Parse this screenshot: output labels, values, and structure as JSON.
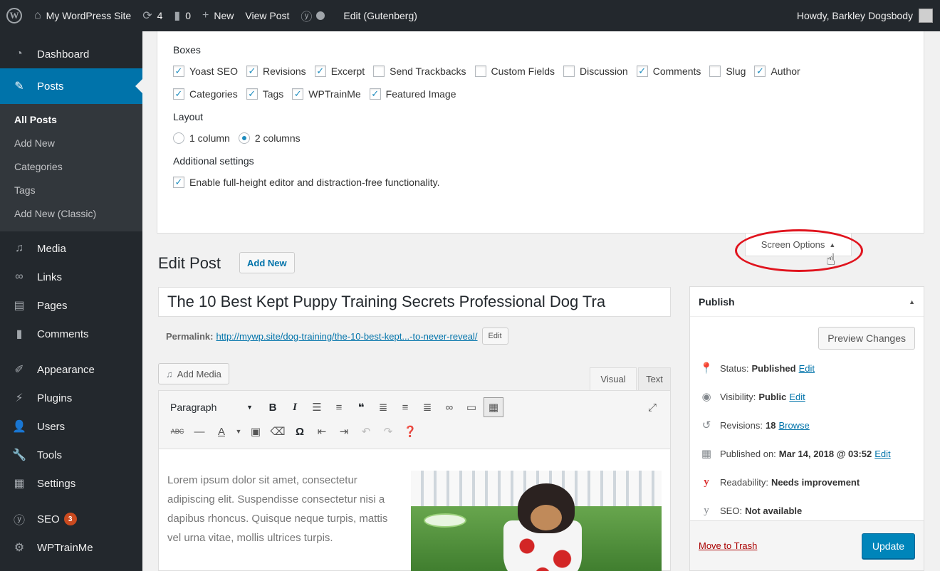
{
  "adminbar": {
    "site_name": "My WordPress Site",
    "updates_count": "4",
    "comments_count": "0",
    "new_label": "New",
    "view_post_label": "View Post",
    "edit_gutenberg_label": "Edit (Gutenberg)",
    "howdy_label": "Howdy, Barkley Dogsbody"
  },
  "sidebar": {
    "dashboard": "Dashboard",
    "posts": "Posts",
    "posts_sub": [
      "All Posts",
      "Add New",
      "Categories",
      "Tags",
      "Add New (Classic)"
    ],
    "media": "Media",
    "links": "Links",
    "pages": "Pages",
    "comments": "Comments",
    "appearance": "Appearance",
    "plugins": "Plugins",
    "users": "Users",
    "tools": "Tools",
    "settings": "Settings",
    "seo": "SEO",
    "seo_badge": "3",
    "wptrainme": "WPTrainMe"
  },
  "screen_options": {
    "boxes_heading": "Boxes",
    "boxes_row1": [
      "Yoast SEO",
      "Revisions",
      "Excerpt",
      "Send Trackbacks",
      "Custom Fields",
      "Discussion",
      "Comments",
      "Slug",
      "Author"
    ],
    "boxes_row2": [
      "Categories",
      "Tags",
      "WPTrainMe",
      "Featured Image"
    ],
    "layout_heading": "Layout",
    "layout_options": [
      "1 column",
      "2 columns"
    ],
    "additional_heading": "Additional settings",
    "additional_option": "Enable full-height editor and distraction-free functionality.",
    "toggle_label": "Screen Options"
  },
  "edit_post": {
    "page_title": "Edit Post",
    "add_new": "Add New",
    "post_title": "The 10 Best Kept Puppy Training Secrets Professional Dog Tra",
    "permalink_label": "Permalink:",
    "permalink_url": "http://mywp.site/dog-training/the-10-best-kept...-to-never-reveal/",
    "permalink_edit": "Edit",
    "add_media": "Add Media",
    "tab_visual": "Visual",
    "tab_text": "Text",
    "format_select": "Paragraph",
    "body_text": "Lorem ipsum dolor sit amet, consectetur adipiscing elit. Suspendisse consectetur nisi a dapibus rhoncus. Quisque neque turpis, mattis vel urna vitae, mollis ultrices turpis."
  },
  "publish": {
    "heading": "Publish",
    "preview_changes": "Preview Changes",
    "status_label": "Status:",
    "status_value": "Published",
    "visibility_label": "Visibility:",
    "visibility_value": "Public",
    "revisions_label": "Revisions:",
    "revisions_value": "18",
    "revisions_link": "Browse",
    "published_label": "Published on:",
    "published_value": "Mar 14, 2018 @ 03:52",
    "readability_label": "Readability:",
    "readability_value": "Needs improvement",
    "seo_label": "SEO:",
    "seo_value": "Not available",
    "edit_link": "Edit",
    "move_to_trash": "Move to Trash",
    "update": "Update"
  },
  "colors": {
    "accent": "#0073aa",
    "adminbar": "#23282d",
    "highlight_ellipse": "#e0141e",
    "primary_button": "#0085ba"
  }
}
